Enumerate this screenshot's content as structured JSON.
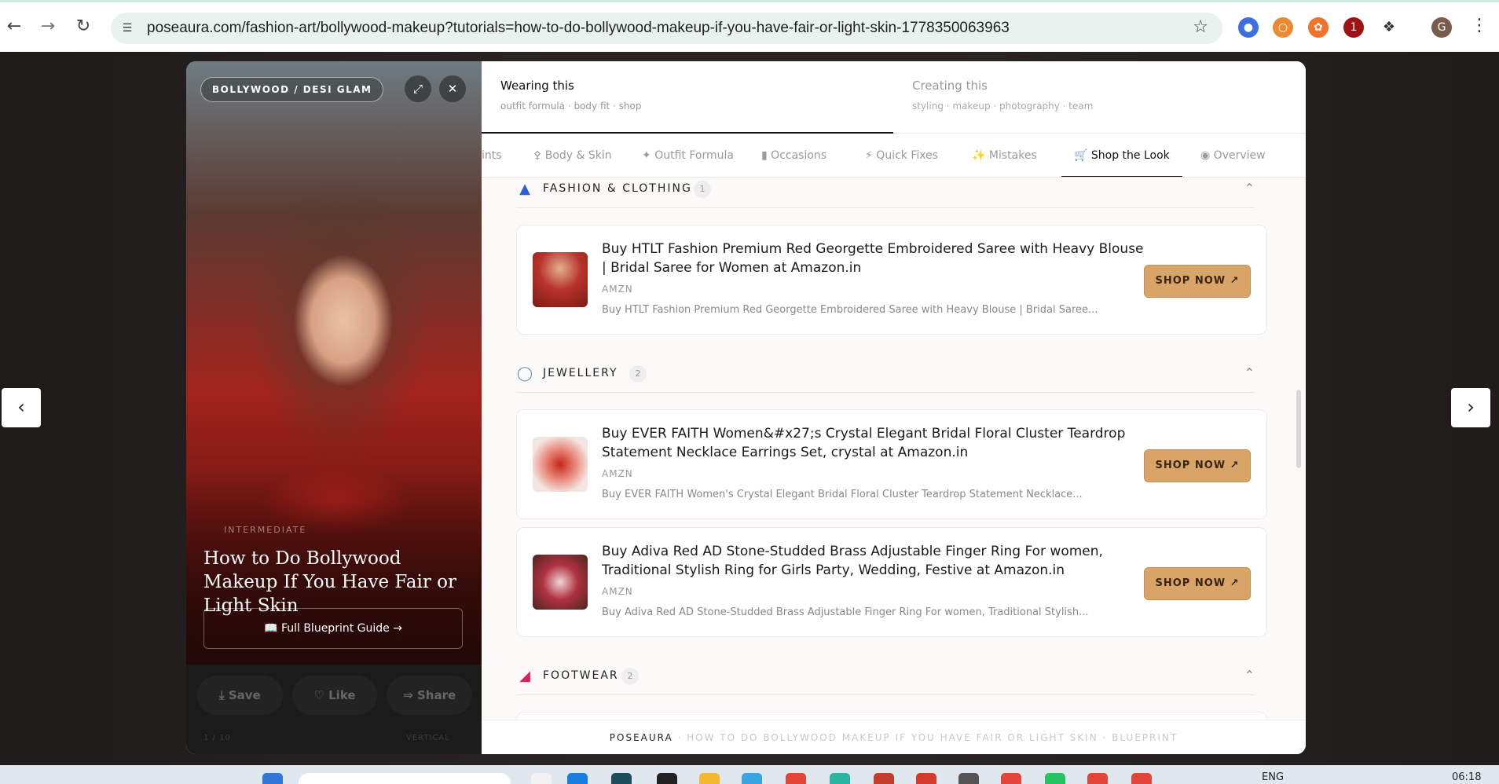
{
  "browser": {
    "url": "poseaura.com/fashion-art/bollywood-makeup?tutorials=how-to-do-bollywood-makeup-if-you-have-fair-or-light-skin-1778350063963",
    "back_icon": "arrow-left-icon",
    "forward_icon": "arrow-right-icon",
    "reload_icon": "reload-icon",
    "profile_initial": "G",
    "extension_badge": "1"
  },
  "hero": {
    "badge": "BOLLYWOOD / DESI GLAM",
    "level": "INTERMEDIATE",
    "title": "How to Do Bollywood Makeup If You Have Fair or Light Skin",
    "blueprint_button": "Full Blueprint Guide",
    "actions": {
      "save": "Save",
      "like": "Like",
      "share": "Share"
    },
    "footer_left": "1 / 10",
    "footer_right": "VERTICAL"
  },
  "top_tabs": [
    {
      "title": "Wearing this",
      "subtitle": "outfit formula · body fit · shop"
    },
    {
      "title": "Creating this",
      "subtitle": "styling · makeup · photography · team"
    }
  ],
  "sub_tabs": [
    "ints",
    "Body & Skin",
    "Outfit Formula",
    "Occasions",
    "Quick Fixes",
    "Mistakes",
    "Shop the Look",
    "Overview"
  ],
  "sections": {
    "fashion": {
      "title": "FASHION & CLOTHING",
      "count": "1"
    },
    "jewellery": {
      "title": "JEWELLERY",
      "count": "2"
    },
    "footwear": {
      "title": "FOOTWEAR",
      "count": "2"
    }
  },
  "products": [
    {
      "title": "Buy HTLT Fashion Premium Red Georgette Embroidered Saree with Heavy Blouse | Bridal Saree for Women at Amazon.in",
      "source": "AMZN",
      "desc": "Buy HTLT Fashion Premium Red Georgette Embroidered Saree with Heavy Blouse | Bridal Saree...",
      "button": "SHOP NOW"
    },
    {
      "title": "Buy EVER FAITH Women&#x27;s Crystal Elegant Bridal Floral Cluster Teardrop Statement Necklace Earrings Set, crystal at Amazon.in",
      "source": "AMZN",
      "desc": "Buy EVER FAITH Women's Crystal Elegant Bridal Floral Cluster Teardrop Statement Necklace...",
      "button": "SHOP NOW"
    },
    {
      "title": "Buy Adiva Red AD Stone-Studded Brass Adjustable Finger Ring For women, Traditional Stylish Ring for Girls Party, Wedding, Festive at Amazon.in",
      "source": "AMZN",
      "desc": "Buy Adiva Red AD Stone-Studded Brass Adjustable Finger Ring For women, Traditional Stylish...",
      "button": "SHOP NOW"
    }
  ],
  "footer": {
    "brand": "POSEAURA",
    "rest": " · HOW TO DO BOLLYWOOD MAKEUP IF YOU HAVE FAIR OR LIGHT SKIN · BLUEPRINT"
  },
  "taskbar": {
    "lang": "ENG",
    "time": "06:18"
  },
  "colors": {
    "accent": "#d8a468",
    "modal_bg": "#ffffff",
    "text": "#1a1a1a"
  }
}
